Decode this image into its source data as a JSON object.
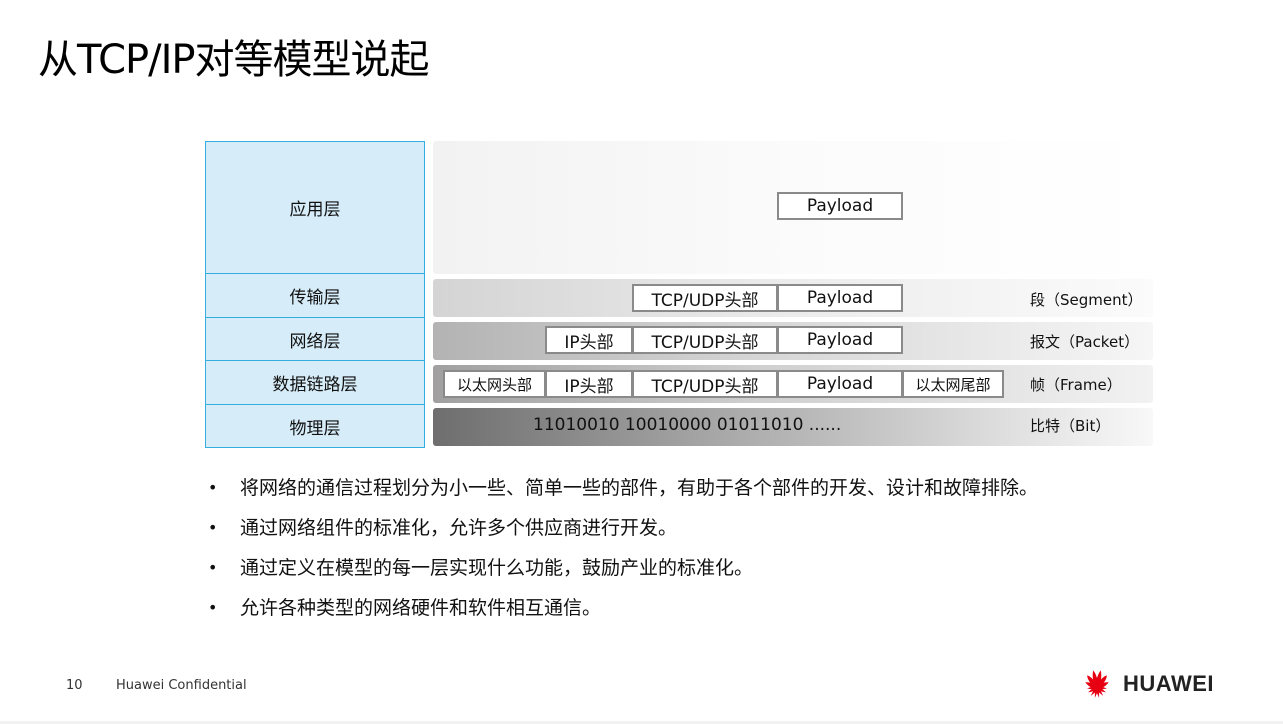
{
  "title": "从TCP/IP对等模型说起",
  "layers": {
    "application": "应用层",
    "transport": "传输层",
    "network": "网络层",
    "datalink": "数据链路层",
    "physical": "物理层"
  },
  "headers": {
    "payload": "Payload",
    "tcp_udp": "TCP/UDP头部",
    "ip": "IP头部",
    "eth_head": "以太网头部",
    "eth_tail": "以太网尾部"
  },
  "bits": "11010010 10010000 01011010 ......",
  "units": {
    "segment": "段（Segment）",
    "packet": "报文（Packet）",
    "frame": "帧（Frame）",
    "bit": "比特（Bit）"
  },
  "bullets": [
    "将网络的通信过程划分为小一些、简单一些的部件，有助于各个部件的开发、设计和故障排除。",
    "通过网络组件的标准化，允许多个供应商进行开发。",
    "通过定义在模型的每一层实现什么功能，鼓励产业的标准化。",
    "允许各种类型的网络硬件和软件相互通信。"
  ],
  "footer": {
    "page_number": "10",
    "confidential": "Huawei Confidential",
    "brand": "HUAWEI"
  },
  "colors": {
    "layer_fill": "#d6ecf8",
    "layer_border": "#34aee0",
    "huawei_red": "#e60012"
  }
}
